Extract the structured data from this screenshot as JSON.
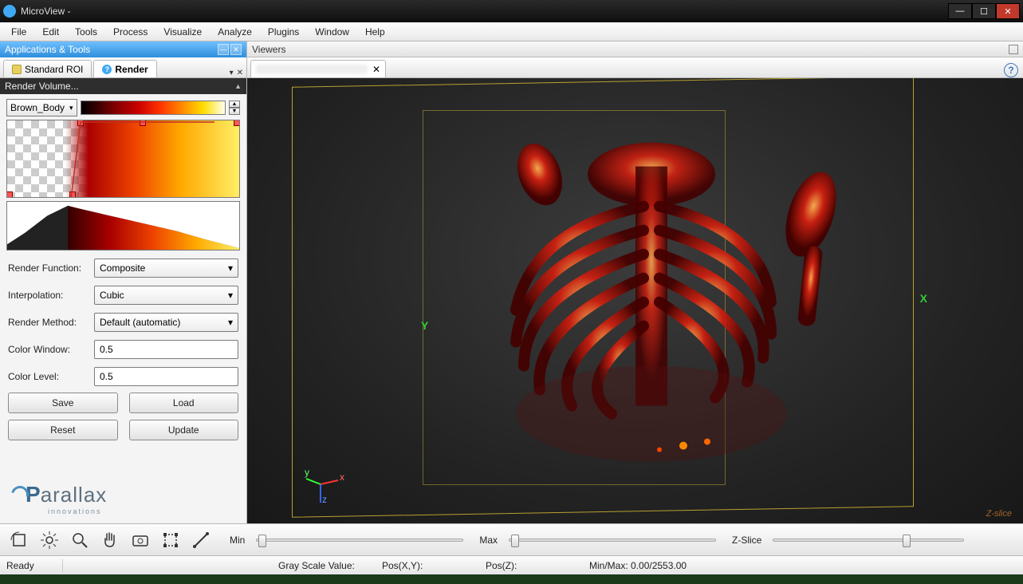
{
  "window": {
    "title": "MicroView -"
  },
  "menu": [
    "File",
    "Edit",
    "Tools",
    "Process",
    "Visualize",
    "Analyze",
    "Plugins",
    "Window",
    "Help"
  ],
  "left_panel": {
    "header": "Applications & Tools",
    "tabs": [
      {
        "label": "Standard ROI"
      },
      {
        "label": "Render"
      }
    ],
    "render_header": "Render Volume...",
    "colormap": "Brown_Body",
    "fields": {
      "render_function_label": "Render Function:",
      "render_function_value": "Composite",
      "interpolation_label": "Interpolation:",
      "interpolation_value": "Cubic",
      "render_method_label": "Render Method:",
      "render_method_value": "Default (automatic)",
      "color_window_label": "Color Window:",
      "color_window_value": "0.5",
      "color_level_label": "Color Level:",
      "color_level_value": "0.5"
    },
    "buttons": {
      "save": "Save",
      "load": "Load",
      "reset": "Reset",
      "update": "Update"
    },
    "logo": {
      "brand": "arallax",
      "tag": "innovations"
    }
  },
  "viewers": {
    "header": "Viewers",
    "axis_x": "X",
    "axis_y": "Y",
    "zslice_overlay": "Z-slice"
  },
  "bottom": {
    "min_label": "Min",
    "max_label": "Max",
    "zslice_label": "Z-Slice"
  },
  "status": {
    "ready": "Ready",
    "gray": "Gray Scale Value:",
    "posxy": "Pos(X,Y):",
    "posz": "Pos(Z):",
    "minmax": "Min/Max: 0.00/2553.00"
  }
}
